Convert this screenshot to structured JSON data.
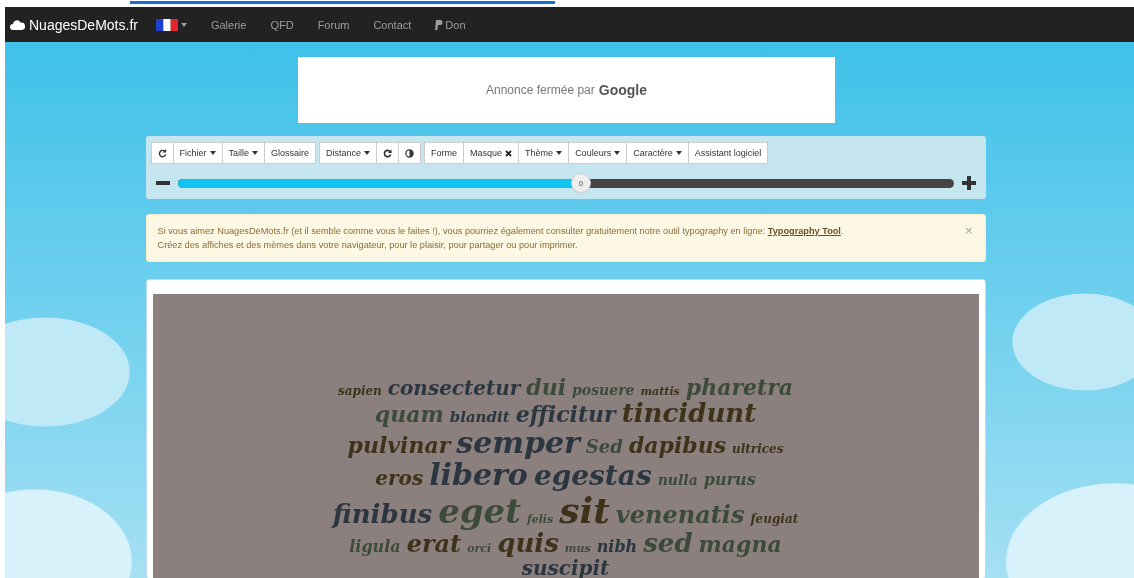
{
  "navbar": {
    "brand": "NuagesDeMots.fr",
    "links": [
      {
        "label": "Galerie",
        "kind": "text"
      },
      {
        "label": "QFD",
        "kind": "text"
      },
      {
        "label": "Forum",
        "kind": "text"
      },
      {
        "label": "Contact",
        "kind": "text"
      },
      {
        "label": "Don",
        "kind": "paypal"
      }
    ]
  },
  "ad": {
    "text": "Annonce fermée par",
    "brand": "Google"
  },
  "toolbar": {
    "groups": [
      [
        {
          "kind": "refresh"
        },
        {
          "kind": "dropdown",
          "label": "Fichier"
        },
        {
          "kind": "dropdown",
          "label": "Taille"
        },
        {
          "kind": "button",
          "label": "Glossaire"
        }
      ],
      [
        {
          "kind": "dropdown",
          "label": "Distance"
        },
        {
          "kind": "redo"
        },
        {
          "kind": "contrast"
        }
      ],
      [
        {
          "kind": "button",
          "label": "Forme"
        },
        {
          "kind": "remove",
          "label": "Masque"
        },
        {
          "kind": "dropdown",
          "label": "Thème"
        },
        {
          "kind": "dropdown",
          "label": "Couleurs"
        },
        {
          "kind": "dropdown",
          "label": "Caractère"
        },
        {
          "kind": "button",
          "label": "Assistant logiciel"
        }
      ]
    ],
    "slider": {
      "level": 0.52,
      "value": "0"
    }
  },
  "alert": {
    "text": "Si vous aimez NuagesDeMots.fr (et il semble comme vous le faites !), vous pourriez également consulter gratuitement notre outil typography en ligne:",
    "link": "Typography Tool",
    "after": ".",
    "close": "×",
    "line2": "Créez des affiches et des mèmes dans votre navigateur, pour le plaisir, pour partager ou pour imprimer."
  },
  "word_cloud": {
    "words": [
      {
        "text": "sapien",
        "color": "#3e321a"
      },
      {
        "text": "consectetur",
        "color": "#2c3640"
      },
      {
        "text": "dui",
        "color": "#3c4a3c"
      },
      {
        "text": "posuere",
        "color": "#3c4a3c"
      },
      {
        "text": "mattis",
        "color": "#3e321a"
      },
      {
        "text": "pharetra",
        "color": "#3c4a3c"
      },
      {
        "text": "quam",
        "color": "#3c4a3c"
      },
      {
        "text": "blandit",
        "color": "#2c3640"
      },
      {
        "text": "efficitur",
        "color": "#2c3640"
      },
      {
        "text": "tincidunt",
        "color": "#3e321a"
      },
      {
        "text": "pulvinar",
        "color": "#3e321a"
      },
      {
        "text": "semper",
        "color": "#2c3640"
      },
      {
        "text": "Sed",
        "color": "#3c4a3c"
      },
      {
        "text": "dapibus",
        "color": "#3e321a"
      },
      {
        "text": "ultrices",
        "color": "#3e321a"
      },
      {
        "text": "eros",
        "color": "#3e321a"
      },
      {
        "text": "libero",
        "color": "#2c3640"
      },
      {
        "text": "egestas",
        "color": "#2c3640"
      },
      {
        "text": "nulla",
        "color": "#3c4a3c"
      },
      {
        "text": "purus",
        "color": "#3c4a3c"
      },
      {
        "text": "finibus",
        "color": "#2c3640"
      },
      {
        "text": "eget",
        "color": "#3c4a3c"
      },
      {
        "text": "felis",
        "color": "#3c4a3c"
      },
      {
        "text": "sit",
        "color": "#3e321a"
      },
      {
        "text": "venenatis",
        "color": "#3c4a3c"
      },
      {
        "text": "feugiat",
        "color": "#3e321a"
      },
      {
        "text": "ligula",
        "color": "#3c4a3c"
      },
      {
        "text": "erat",
        "color": "#3e321a"
      },
      {
        "text": "orci",
        "color": "#3c4a3c"
      },
      {
        "text": "quis",
        "color": "#3e321a"
      },
      {
        "text": "mus",
        "color": "#3c4a3c"
      },
      {
        "text": "nibh",
        "color": "#2c3640"
      },
      {
        "text": "sed",
        "color": "#3c4a3c"
      },
      {
        "text": "magna",
        "color": "#3c4a3c"
      },
      {
        "text": "suscipit",
        "color": "#2c3640"
      }
    ]
  }
}
